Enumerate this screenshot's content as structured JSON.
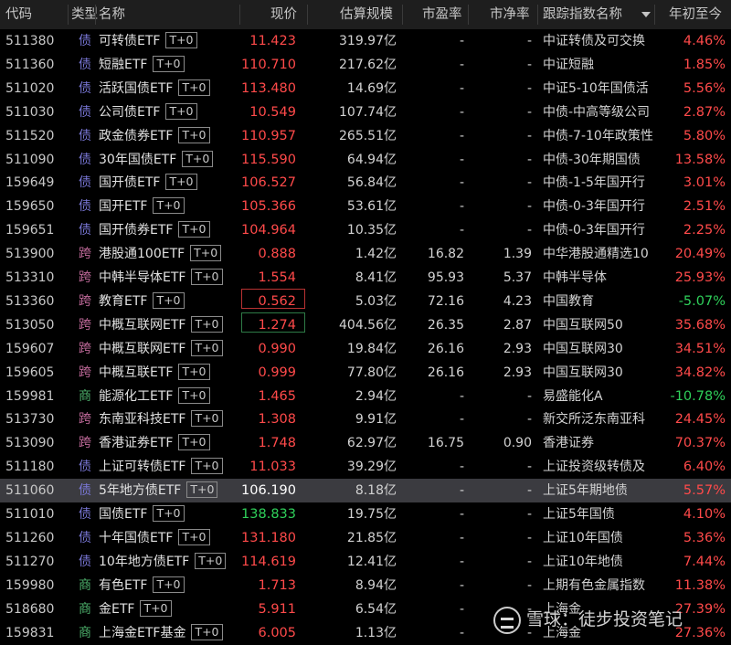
{
  "header": {
    "code": "代码",
    "type": "类型",
    "name": "名称",
    "price": "现价",
    "scale": "估算规模",
    "pe": "市盈率",
    "pb": "市净率",
    "index": "跟踪指数名称",
    "ytd": "年初至今"
  },
  "colors": {
    "up": "#ff4a4a",
    "down": "#2fd05a",
    "selected_row": "#3b3b40"
  },
  "sort": {
    "column": "index",
    "icon": "sort-down-icon"
  },
  "rows": [
    {
      "code": "511380",
      "type": "债",
      "name": "可转债ETF",
      "tag": "T+0",
      "price": "11.423",
      "scale": "319.97亿",
      "pe": "-",
      "pb": "-",
      "index": "中证转债及可交换",
      "ytd": "4.46%",
      "pc": "red",
      "yc": "red",
      "tc": "t-debt"
    },
    {
      "code": "511360",
      "type": "债",
      "name": "短融ETF",
      "tag": "T+0",
      "price": "110.710",
      "scale": "217.62亿",
      "pe": "-",
      "pb": "-",
      "index": "中证短融",
      "ytd": "1.85%",
      "pc": "red",
      "yc": "red",
      "tc": "t-debt"
    },
    {
      "code": "511020",
      "type": "债",
      "name": "活跃国债ETF",
      "tag": "T+0",
      "price": "113.480",
      "scale": "14.69亿",
      "pe": "-",
      "pb": "-",
      "index": "中证5-10年国债活",
      "ytd": "5.56%",
      "pc": "red",
      "yc": "red",
      "tc": "t-debt"
    },
    {
      "code": "511030",
      "type": "债",
      "name": "公司债ETF",
      "tag": "T+0",
      "price": "10.549",
      "scale": "107.74亿",
      "pe": "-",
      "pb": "-",
      "index": "中债-中高等级公司",
      "ytd": "2.87%",
      "pc": "red",
      "yc": "red",
      "tc": "t-debt"
    },
    {
      "code": "511520",
      "type": "债",
      "name": "政金债券ETF",
      "tag": "T+0",
      "price": "110.957",
      "scale": "265.51亿",
      "pe": "-",
      "pb": "-",
      "index": "中债-7-10年政策性",
      "ytd": "5.80%",
      "pc": "red",
      "yc": "red",
      "tc": "t-debt"
    },
    {
      "code": "511090",
      "type": "债",
      "name": "30年国债ETF",
      "tag": "T+0",
      "price": "115.590",
      "scale": "64.94亿",
      "pe": "-",
      "pb": "-",
      "index": "中债-30年期国债",
      "ytd": "13.58%",
      "pc": "red",
      "yc": "red",
      "tc": "t-debt"
    },
    {
      "code": "159649",
      "type": "债",
      "name": "国开债ETF",
      "tag": "T+0",
      "price": "106.527",
      "scale": "56.84亿",
      "pe": "-",
      "pb": "-",
      "index": "中债-1-5年国开行",
      "ytd": "3.01%",
      "pc": "red",
      "yc": "red",
      "tc": "t-debt"
    },
    {
      "code": "159650",
      "type": "债",
      "name": "国开ETF",
      "tag": "T+0",
      "price": "105.366",
      "scale": "53.61亿",
      "pe": "-",
      "pb": "-",
      "index": "中债-0-3年国开行",
      "ytd": "2.51%",
      "pc": "red",
      "yc": "red",
      "tc": "t-debt"
    },
    {
      "code": "159651",
      "type": "债",
      "name": "国开债券ETF",
      "tag": "T+0",
      "price": "104.964",
      "scale": "10.35亿",
      "pe": "-",
      "pb": "-",
      "index": "中债-0-3年国开行",
      "ytd": "2.25%",
      "pc": "red",
      "yc": "red",
      "tc": "t-debt"
    },
    {
      "code": "513900",
      "type": "跨",
      "name": "港股通100ETF",
      "tag": "T+0",
      "price": "0.888",
      "scale": "1.42亿",
      "pe": "16.82",
      "pb": "1.39",
      "index": "中华港股通精选10",
      "ytd": "20.49%",
      "pc": "red",
      "yc": "red",
      "tc": "t-cross"
    },
    {
      "code": "513310",
      "type": "跨",
      "name": "中韩半导体ETF",
      "tag": "T+0",
      "price": "1.554",
      "scale": "8.41亿",
      "pe": "95.93",
      "pb": "5.37",
      "index": "中韩半导体",
      "ytd": "25.93%",
      "pc": "red",
      "yc": "red",
      "tc": "t-cross"
    },
    {
      "code": "513360",
      "type": "跨",
      "name": "教育ETF",
      "tag": "T+0",
      "price": "0.562",
      "scale": "5.03亿",
      "pe": "72.16",
      "pb": "4.23",
      "index": "中国教育",
      "ytd": "-5.07%",
      "pc": "red",
      "yc": "green",
      "tc": "t-cross"
    },
    {
      "code": "513050",
      "type": "跨",
      "name": "中概互联网ETF",
      "tag": "T+0",
      "price": "1.274",
      "scale": "404.56亿",
      "pe": "26.35",
      "pb": "2.87",
      "index": "中国互联网50",
      "ytd": "35.68%",
      "pc": "red",
      "yc": "red",
      "tc": "t-cross"
    },
    {
      "code": "159607",
      "type": "跨",
      "name": "中概互联网ETF",
      "tag": "T+0",
      "price": "0.990",
      "scale": "19.84亿",
      "pe": "26.16",
      "pb": "2.93",
      "index": "中国互联网30",
      "ytd": "34.51%",
      "pc": "red",
      "yc": "red",
      "tc": "t-cross"
    },
    {
      "code": "159605",
      "type": "跨",
      "name": "中概互联ETF",
      "tag": "T+0",
      "price": "0.999",
      "scale": "77.80亿",
      "pe": "26.16",
      "pb": "2.93",
      "index": "中国互联网30",
      "ytd": "34.82%",
      "pc": "red",
      "yc": "red",
      "tc": "t-cross"
    },
    {
      "code": "159981",
      "type": "商",
      "name": "能源化工ETF",
      "tag": "T+0",
      "price": "1.465",
      "scale": "2.94亿",
      "pe": "-",
      "pb": "-",
      "index": "易盛能化A",
      "ytd": "-10.78%",
      "pc": "red",
      "yc": "green",
      "tc": "t-comm"
    },
    {
      "code": "513730",
      "type": "跨",
      "name": "东南亚科技ETF",
      "tag": "T+0",
      "price": "1.308",
      "scale": "9.91亿",
      "pe": "-",
      "pb": "-",
      "index": "新交所泛东南亚科",
      "ytd": "24.45%",
      "pc": "red",
      "yc": "red",
      "tc": "t-cross"
    },
    {
      "code": "513090",
      "type": "跨",
      "name": "香港证券ETF",
      "tag": "T+0",
      "price": "1.748",
      "scale": "62.97亿",
      "pe": "16.75",
      "pb": "0.90",
      "index": "香港证券",
      "ytd": "70.37%",
      "pc": "red",
      "yc": "red",
      "tc": "t-cross"
    },
    {
      "code": "511180",
      "type": "债",
      "name": "上证可转债ETF",
      "tag": "T+0",
      "price": "11.033",
      "scale": "39.29亿",
      "pe": "-",
      "pb": "-",
      "index": "上证投资级转债及",
      "ytd": "6.40%",
      "pc": "red",
      "yc": "red",
      "tc": "t-debt"
    },
    {
      "code": "511060",
      "type": "债",
      "name": "5年地方债ETF",
      "tag": "T+0",
      "price": "106.190",
      "scale": "8.18亿",
      "pe": "-",
      "pb": "-",
      "index": "上证5年期地债",
      "ytd": "5.57%",
      "pc": "white",
      "yc": "red",
      "tc": "t-debt",
      "sel": true
    },
    {
      "code": "511010",
      "type": "债",
      "name": "国债ETF",
      "tag": "T+0",
      "price": "138.833",
      "scale": "19.75亿",
      "pe": "-",
      "pb": "-",
      "index": "上证5年国债",
      "ytd": "4.10%",
      "pc": "green",
      "yc": "red",
      "tc": "t-debt"
    },
    {
      "code": "511260",
      "type": "债",
      "name": "十年国债ETF",
      "tag": "T+0",
      "price": "131.180",
      "scale": "21.85亿",
      "pe": "-",
      "pb": "-",
      "index": "上证10年国债",
      "ytd": "5.36%",
      "pc": "red",
      "yc": "red",
      "tc": "t-debt"
    },
    {
      "code": "511270",
      "type": "债",
      "name": "10年地方债ETF",
      "tag": "T+0",
      "price": "114.619",
      "scale": "12.41亿",
      "pe": "-",
      "pb": "-",
      "index": "上证10年地债",
      "ytd": "7.44%",
      "pc": "red",
      "yc": "red",
      "tc": "t-debt"
    },
    {
      "code": "159980",
      "type": "商",
      "name": "有色ETF",
      "tag": "T+0",
      "price": "1.713",
      "scale": "8.94亿",
      "pe": "-",
      "pb": "-",
      "index": "上期有色金属指数",
      "ytd": "11.38%",
      "pc": "red",
      "yc": "red",
      "tc": "t-comm"
    },
    {
      "code": "518680",
      "type": "商",
      "name": "金ETF",
      "tag": "T+0",
      "price": "5.911",
      "scale": "6.54亿",
      "pe": "-",
      "pb": "-",
      "index": "上海金",
      "ytd": "27.39%",
      "pc": "red",
      "yc": "red",
      "tc": "t-comm"
    },
    {
      "code": "159831",
      "type": "商",
      "name": "上海金ETF基金",
      "tag": "T+0",
      "price": "6.005",
      "scale": "1.13亿",
      "pe": "-",
      "pb": "-",
      "index": "上海金",
      "ytd": "27.36%",
      "pc": "red",
      "yc": "red",
      "tc": "t-comm"
    }
  ],
  "watermark": {
    "text": "雪球：徒步投资笔记",
    "icon": "xueqiu-logo-icon"
  }
}
